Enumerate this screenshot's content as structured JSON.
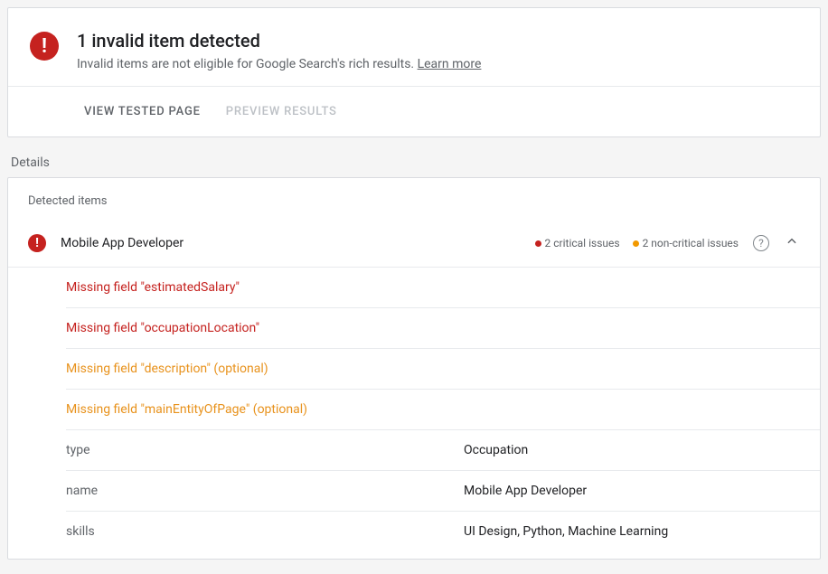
{
  "alert": {
    "title": "1 invalid item detected",
    "subtitle_prefix": "Invalid items are not eligible for Google Search's rich results. ",
    "learn_more": "Learn more"
  },
  "tabs": {
    "view_tested": "VIEW TESTED PAGE",
    "preview_results": "PREVIEW RESULTS"
  },
  "details": {
    "section_label": "Details",
    "detected_label": "Detected items",
    "item_name": "Mobile App Developer",
    "critical_count_label": "2 critical issues",
    "noncritical_count_label": "2 non-critical issues",
    "issues": [
      {
        "text": "Missing field \"estimatedSalary\"",
        "severity": "critical"
      },
      {
        "text": "Missing field \"occupationLocation\"",
        "severity": "critical"
      },
      {
        "text": "Missing field \"description\" (optional)",
        "severity": "warning"
      },
      {
        "text": "Missing field \"mainEntityOfPage\" (optional)",
        "severity": "warning"
      }
    ],
    "properties": [
      {
        "key": "type",
        "value": "Occupation"
      },
      {
        "key": "name",
        "value": "Mobile App Developer"
      },
      {
        "key": "skills",
        "value": "UI Design, Python, Machine Learning"
      }
    ]
  }
}
